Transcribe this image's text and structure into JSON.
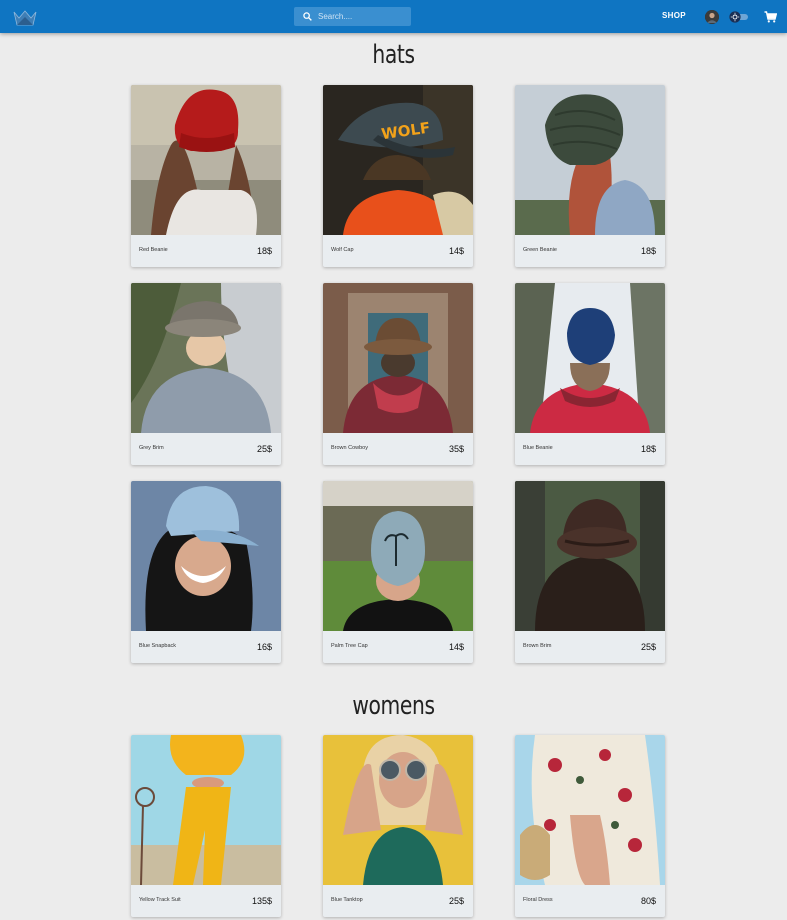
{
  "header": {
    "search_placeholder": "Search....",
    "shop_label": "SHOP",
    "brand_color": "#0f75c2",
    "icons": [
      "crown-logo-icon",
      "search-icon",
      "avatar",
      "theme-toggle-icon",
      "cart-icon"
    ]
  },
  "sections": [
    {
      "title": "hats",
      "products": [
        {
          "name": "Red Beanie",
          "price": "18$"
        },
        {
          "name": "Wolf Cap",
          "price": "14$"
        },
        {
          "name": "Green Beanie",
          "price": "18$"
        },
        {
          "name": "Grey Brim",
          "price": "25$"
        },
        {
          "name": "Brown Cowboy",
          "price": "35$"
        },
        {
          "name": "Blue Beanie",
          "price": "18$"
        },
        {
          "name": "Blue Snapback",
          "price": "16$"
        },
        {
          "name": "Palm Tree Cap",
          "price": "14$"
        },
        {
          "name": "Brown Brim",
          "price": "25$"
        }
      ]
    },
    {
      "title": "womens",
      "products": [
        {
          "name": "Yellow Track Suit",
          "price": "135$"
        },
        {
          "name": "Blue Tanktop",
          "price": "25$"
        },
        {
          "name": "Floral Dress",
          "price": "80$"
        }
      ]
    }
  ]
}
